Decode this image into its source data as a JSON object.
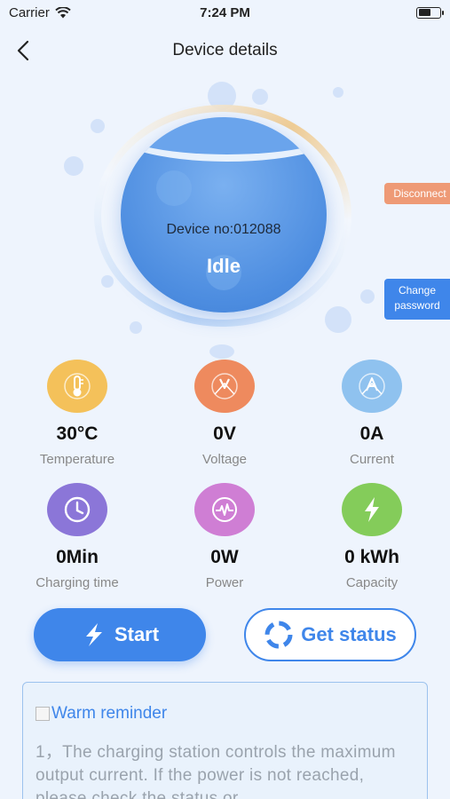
{
  "status_bar": {
    "carrier": "Carrier",
    "time": "7:24 PM"
  },
  "nav": {
    "title": "Device details",
    "back_icon": "chevron-left-icon"
  },
  "device": {
    "number_text": "Device no:012088",
    "state": "Idle"
  },
  "actions_side": {
    "disconnect": "Disconnect",
    "change_password": "Change password"
  },
  "stats": [
    {
      "value": "30°C",
      "label": "Temperature",
      "icon": "thermometer-icon",
      "color": "#f4c15a"
    },
    {
      "value": "0V",
      "label": "Voltage",
      "icon": "voltage-icon",
      "color": "#ee8a5e"
    },
    {
      "value": "0A",
      "label": "Current",
      "icon": "current-icon",
      "color": "#8fc2ef"
    },
    {
      "value": "0Min",
      "label": "Charging time",
      "icon": "clock-icon",
      "color": "#8b76d8"
    },
    {
      "value": "0W",
      "label": "Power",
      "icon": "power-wave-icon",
      "color": "#cf7ed4"
    },
    {
      "value": "0 kWh",
      "label": "Capacity",
      "icon": "lightning-icon",
      "color": "#84cc5a"
    }
  ],
  "buttons": {
    "start": "Start",
    "get_status": "Get status"
  },
  "reminder": {
    "title": "Warm reminder",
    "text": "1，The charging station controls the maximum output current. If the power is not reached, please check the status or"
  },
  "colors": {
    "accent": "#3f86ea",
    "disconnect": "#ee9a76",
    "background": "#eef4fd"
  }
}
